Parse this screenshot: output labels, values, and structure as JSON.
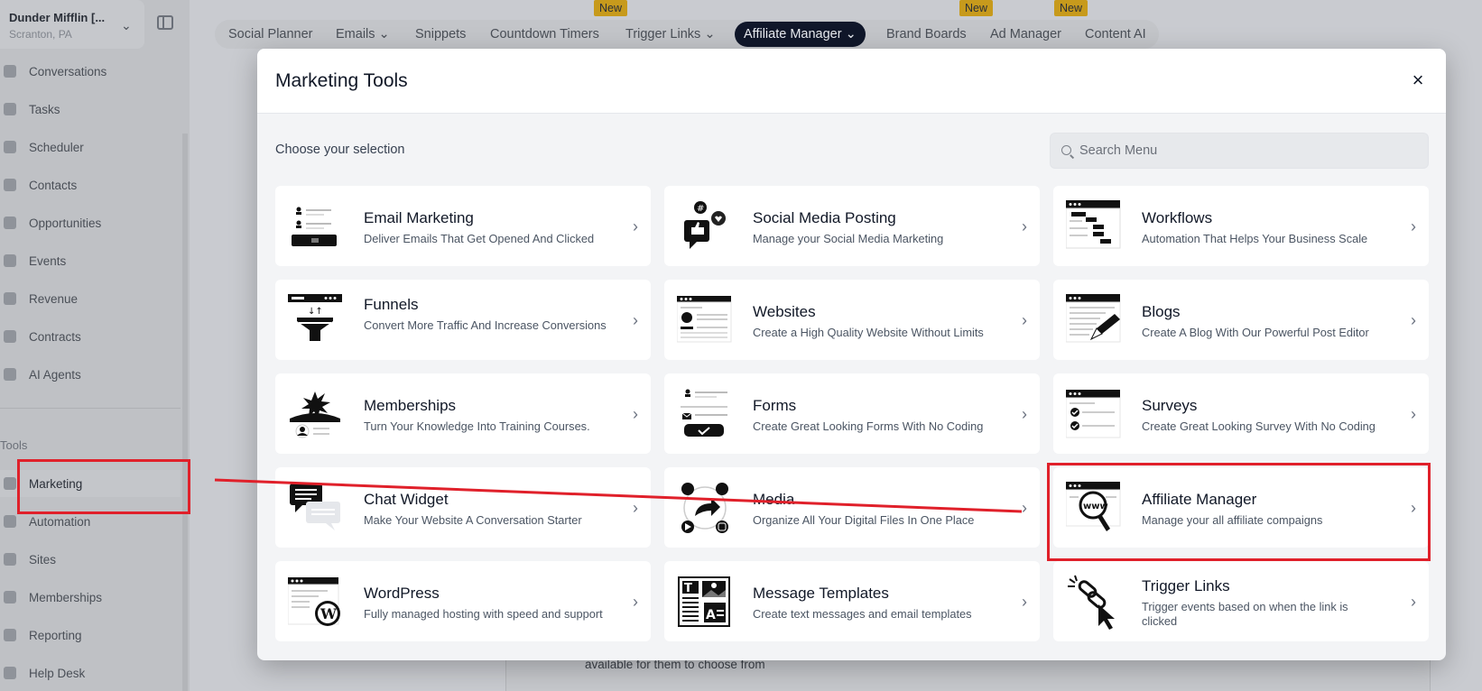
{
  "sidebar": {
    "org_name": "Dunder Mifflin [...",
    "org_location": "Scranton, PA",
    "items": [
      {
        "label": "Conversations",
        "icon": "chat-icon"
      },
      {
        "label": "Tasks",
        "icon": "clipboard-icon"
      },
      {
        "label": "Scheduler",
        "icon": "calendar-icon"
      },
      {
        "label": "Contacts",
        "icon": "person-icon"
      },
      {
        "label": "Opportunities",
        "icon": "target-icon"
      },
      {
        "label": "Events",
        "icon": "calendar-event-icon"
      },
      {
        "label": "Revenue",
        "icon": "card-icon"
      },
      {
        "label": "Contracts",
        "icon": "document-icon"
      },
      {
        "label": "AI Agents",
        "icon": "sparkle-icon"
      }
    ],
    "tools_label": "Tools",
    "tool_items": [
      {
        "label": "Marketing",
        "icon": "megaphone-icon"
      },
      {
        "label": "Automation",
        "icon": "gears-icon"
      },
      {
        "label": "Sites",
        "icon": "globe-icon"
      },
      {
        "label": "Memberships",
        "icon": "group-icon"
      },
      {
        "label": "Reporting",
        "icon": "pie-icon"
      },
      {
        "label": "Help Desk",
        "icon": "help-icon"
      }
    ]
  },
  "topnav": {
    "items": [
      "Social Planner",
      "Emails",
      "Snippets",
      "Countdown Timers",
      "Trigger Links",
      "Affiliate Manager",
      "Brand Boards",
      "Ad Manager",
      "Content AI"
    ],
    "new_badge": "New"
  },
  "background_text": "available for them to choose from",
  "modal": {
    "title": "Marketing Tools",
    "close": "×",
    "choose_label": "Choose your selection",
    "search_placeholder": "Search Menu",
    "cards": [
      {
        "title": "Email Marketing",
        "desc": "Deliver Emails That Get Opened And Clicked"
      },
      {
        "title": "Social Media Posting",
        "desc": "Manage your Social Media Marketing"
      },
      {
        "title": "Workflows",
        "desc": "Automation That Helps Your Business Scale"
      },
      {
        "title": "Funnels",
        "desc": "Convert More Traffic And Increase Conversions"
      },
      {
        "title": "Websites",
        "desc": "Create a High Quality Website Without Limits"
      },
      {
        "title": "Blogs",
        "desc": "Create A Blog With Our Powerful Post Editor"
      },
      {
        "title": "Memberships",
        "desc": "Turn Your Knowledge Into Training Courses."
      },
      {
        "title": "Forms",
        "desc": "Create Great Looking Forms With No Coding"
      },
      {
        "title": "Surveys",
        "desc": "Create Great Looking Survey With No Coding"
      },
      {
        "title": "Chat Widget",
        "desc": "Make Your Website A Conversation Starter"
      },
      {
        "title": "Media",
        "desc": "Organize All Your Digital Files In One Place"
      },
      {
        "title": "Affiliate Manager",
        "desc": "Manage your all affiliate compaigns"
      },
      {
        "title": "WordPress",
        "desc": "Fully managed hosting with speed and support"
      },
      {
        "title": "Message Templates",
        "desc": "Create text messages and email templates"
      },
      {
        "title": "Trigger Links",
        "desc": "Trigger events based on when the link is clicked"
      }
    ],
    "arrow_glyph": "›"
  },
  "annotation_color": "#e0202a"
}
